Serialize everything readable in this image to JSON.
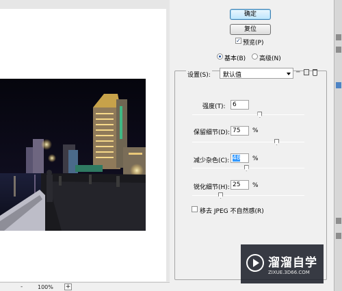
{
  "preview": {
    "zoom_minus": "-",
    "zoom_value": "100%",
    "zoom_plus": "+"
  },
  "dialog": {
    "ok_label": "确定",
    "reset_label": "复位",
    "preview_label": "预览(P)",
    "preview_checked": true,
    "mode_basic_label": "基本(B)",
    "mode_advanced_label": "高级(N)",
    "mode_selected": "basic",
    "settings_label": "设置(S):",
    "settings_value": "默认值",
    "strength_label": "强度(T):",
    "strength_value": "6",
    "strength_level": 6,
    "strength_max": 10,
    "preserve_details_label": "保留细节(D):",
    "preserve_details_value": "75",
    "preserve_details_unit": "%",
    "reduce_color_noise_label": "减少杂色(C):",
    "reduce_color_noise_value": "48",
    "reduce_color_noise_unit": "%",
    "sharpen_details_label": "锐化细节(H):",
    "sharpen_details_value": "25",
    "sharpen_details_unit": "%",
    "remove_jpeg_label": "移去 JPEG 不自然感(R)",
    "remove_jpeg_checked": false
  },
  "watermark": {
    "name": "溜溜自学",
    "url": "ZIXUE.3D66.COM"
  },
  "colors": {
    "dialog_bg": "#f0f0f0",
    "ok_border": "#3c7fb1",
    "selection": "#3399ff",
    "watermark_bg": "#181c26"
  }
}
